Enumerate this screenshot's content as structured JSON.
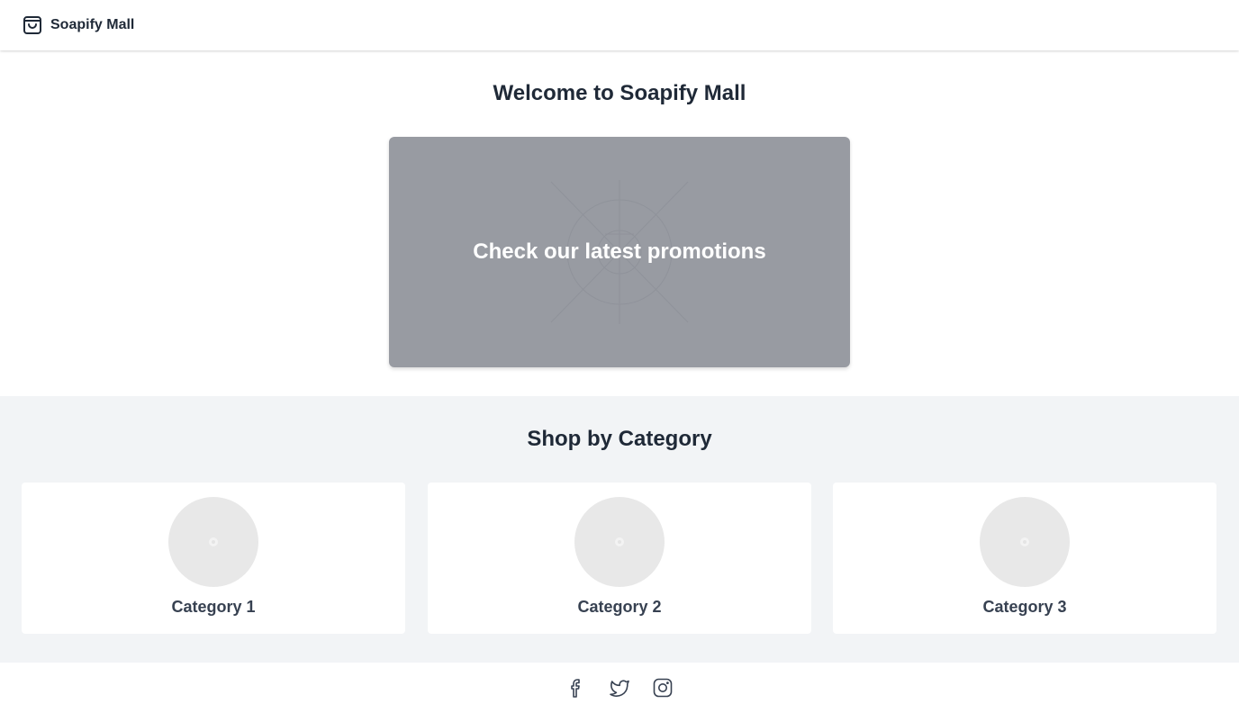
{
  "header": {
    "brand_name": "Soapify Mall",
    "brand_icon": "shopping-bag-icon"
  },
  "hero": {
    "title": "Welcome to Soapify Mall",
    "promo_text": "Check our latest promotions"
  },
  "categories": {
    "title": "Shop by Category",
    "items": [
      {
        "label": "Category 1"
      },
      {
        "label": "Category 2"
      },
      {
        "label": "Category 3"
      }
    ]
  },
  "footer": {
    "social_icons": [
      "facebook-icon",
      "twitter-icon",
      "instagram-icon"
    ]
  },
  "colors": {
    "text_primary": "#1f2937",
    "promo_bg": "#989ba2",
    "section_bg": "#f2f4f6",
    "placeholder": "#e8e8e8"
  }
}
